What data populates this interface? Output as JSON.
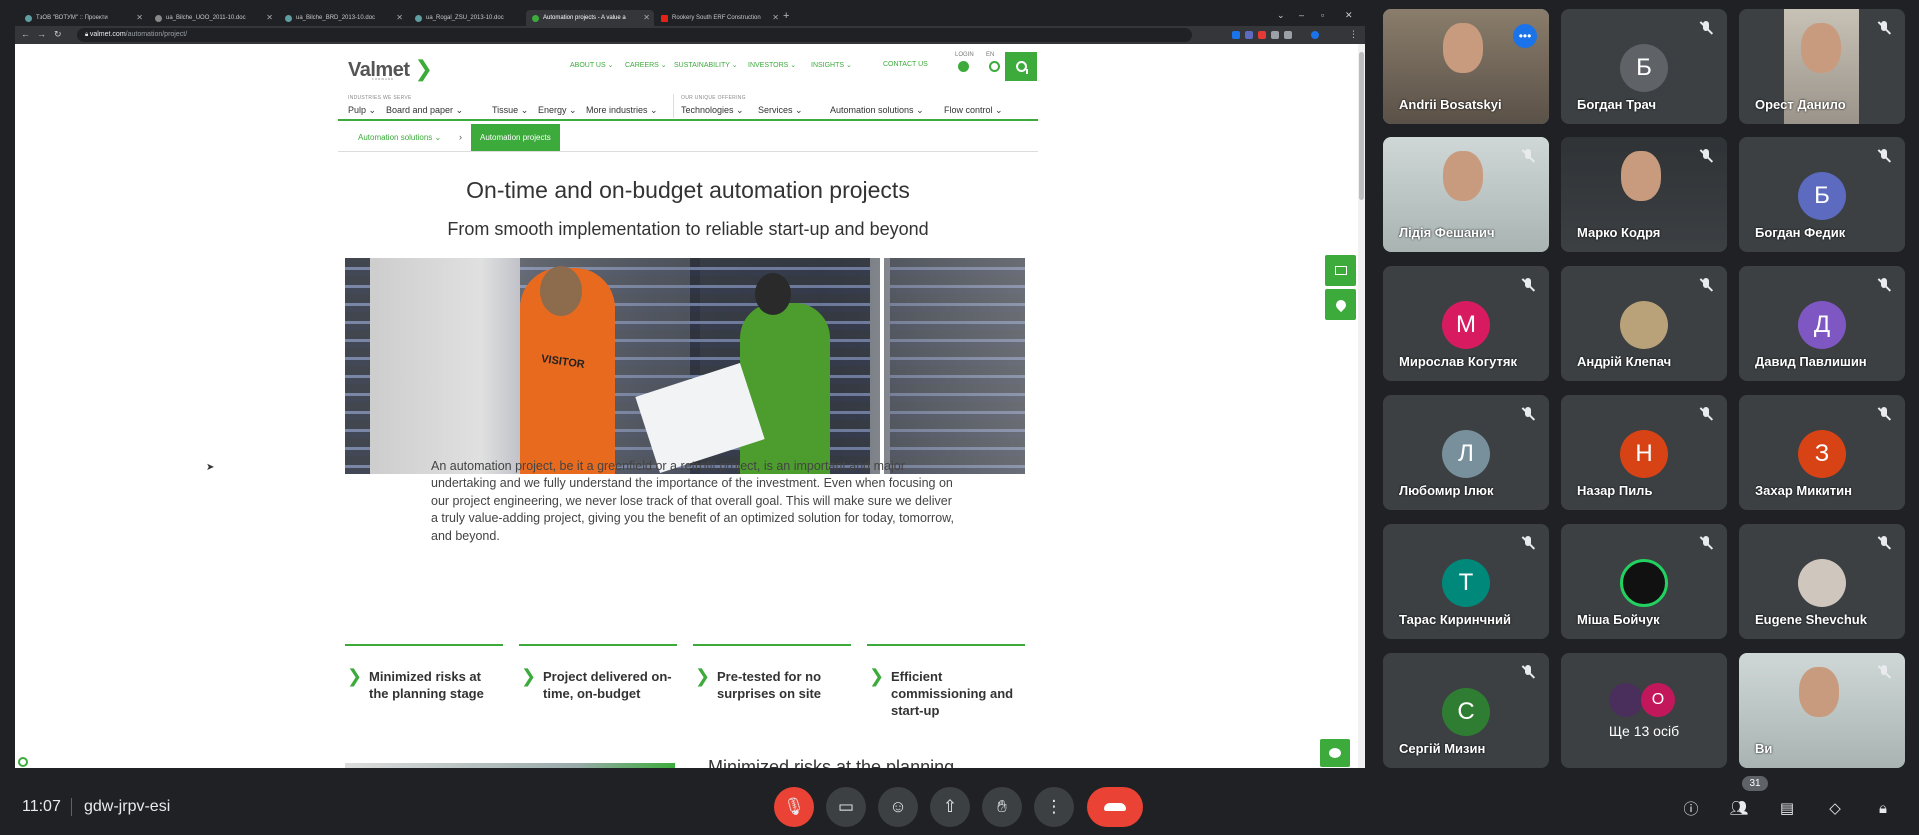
{
  "browser": {
    "tabs": [
      {
        "title": "ТзОВ \"ВОТУМ\" :: Проекти",
        "active": false
      },
      {
        "title": "ua_Bilche_UOO_2011-10.doc",
        "active": false
      },
      {
        "title": "ua_Bilche_BRD_2013-10.doc",
        "active": false
      },
      {
        "title": "ua_Rogal_ZSU_2013-10.doc",
        "active": false
      },
      {
        "title": "Automation projects - A value a",
        "active": true
      },
      {
        "title": "Rookery South ERF Construction",
        "active": false
      }
    ],
    "url_host": "valmet.com",
    "url_path": "/automation/project/"
  },
  "site": {
    "logo": "Valmet",
    "logo_tagline": "FORWARD",
    "top_nav": [
      "ABOUT US",
      "CAREERS",
      "SUSTAINABILITY",
      "INVESTORS",
      "INSIGHTS",
      "CONTACT US"
    ],
    "login_label": "LOGIN",
    "lang_label": "EN",
    "industries_label": "INDUSTRIES WE SERVE",
    "industries": [
      "Pulp",
      "Board and paper",
      "Tissue",
      "Energy",
      "More industries"
    ],
    "offering_label": "OUR UNIQUE OFFERING",
    "offering": [
      "Technologies",
      "Services",
      "Automation solutions",
      "Flow control"
    ],
    "breadcrumb_parent": "Automation solutions",
    "breadcrumb_current": "Automation projects",
    "heading": "On-time and on-budget automation projects",
    "subheading": "From smooth implementation to reliable start-up and beyond",
    "hero_text": "VISITOR",
    "intro": "An automation project, be it a greenfield or a retrofit project, is an important and major undertaking and we fully understand the importance of the investment. Even when focusing on our project engineering, we never lose track of that overall goal. This will make sure we deliver a truly value-adding project, giving you the benefit of an optimized solution for today, tomorrow, and beyond.",
    "features": [
      "Minimized risks at the planning stage",
      "Project delivered on-time, on-budget",
      "Pre-tested for no surprises on site",
      "Efficient commissioning and start-up"
    ],
    "next_heading": "Minimized risks at the planning"
  },
  "meet": {
    "participants": [
      {
        "name": "Andrii Bosatskyi",
        "type": "video",
        "selected": true
      },
      {
        "name": "Богдан Трач",
        "type": "avatar",
        "initial": "Б",
        "color": "#5f6368"
      },
      {
        "name": "Орест Данило",
        "type": "video"
      },
      {
        "name": "Лідія Фешанич",
        "type": "video"
      },
      {
        "name": "Марко Кодря",
        "type": "video"
      },
      {
        "name": "Богдан Федик",
        "type": "avatar",
        "initial": "Б",
        "color": "#5c6bc0"
      },
      {
        "name": "Мирослав Когутяк",
        "type": "avatar",
        "initial": "М",
        "color": "#d81b60"
      },
      {
        "name": "Андрій Клепач",
        "type": "photo"
      },
      {
        "name": "Давид Павлишин",
        "type": "avatar",
        "initial": "Д",
        "color": "#7e57c2"
      },
      {
        "name": "Любомир Ілюк",
        "type": "avatar",
        "initial": "Л",
        "color": "#78909c"
      },
      {
        "name": "Назар Пиль",
        "type": "avatar",
        "initial": "Н",
        "color": "#d84315"
      },
      {
        "name": "Захар Микитин",
        "type": "avatar",
        "initial": "З",
        "color": "#d84315"
      },
      {
        "name": "Тарас Киринчний",
        "type": "avatar",
        "initial": "Т",
        "color": "#00897b"
      },
      {
        "name": "Міша Бойчук",
        "type": "photo"
      },
      {
        "name": "Eugene Shevchuk",
        "type": "photo"
      },
      {
        "name": "Сергій Мизин",
        "type": "avatar",
        "initial": "С",
        "color": "#2e7d32"
      },
      {
        "name": "Ще 13 осіб",
        "type": "others",
        "initial": "О"
      },
      {
        "name": "Ви",
        "type": "video"
      }
    ],
    "time": "11:07",
    "meeting_code": "gdw-jrpv-esi",
    "participant_count": "31"
  }
}
